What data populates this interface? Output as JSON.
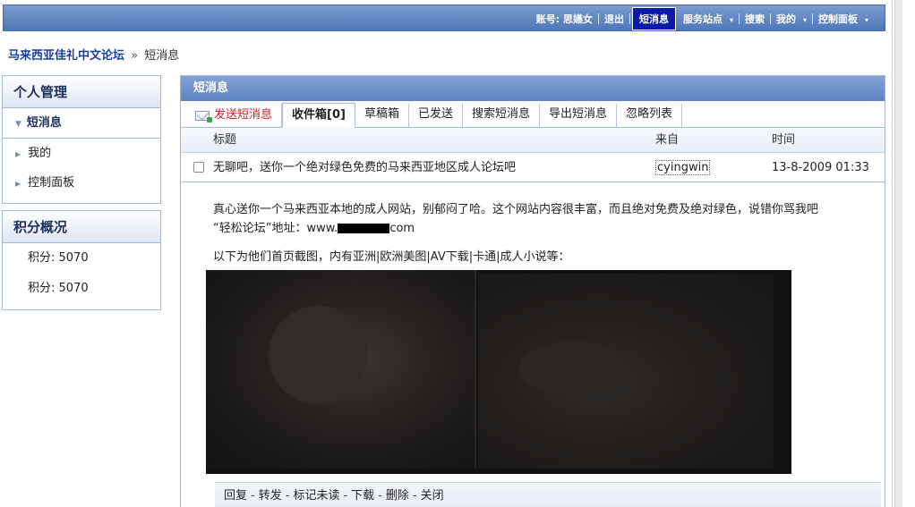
{
  "topnav": {
    "account": "账号: 思嬿女",
    "logout": "退出",
    "messages": "短消息",
    "services": "服务站点",
    "search": "搜索",
    "mine": "我的",
    "control_panel": "控制面板",
    "arrow": "▾"
  },
  "breadcrumb": {
    "home": "马来西亚佳礼中文论坛",
    "separator": "»",
    "current": "短消息"
  },
  "sidebar": {
    "personal": {
      "title": "个人管理",
      "active_item": "短消息",
      "items": [
        "我的",
        "控制面板"
      ]
    },
    "points": {
      "title": "积分概况",
      "rows": [
        "积分: 5070",
        "积分: 5070"
      ]
    }
  },
  "panel": {
    "title": "短消息",
    "tabs": [
      "发送短消息",
      "收件箱[0]",
      "草稿箱",
      "已发送",
      "搜索短消息",
      "导出短消息",
      "忽略列表"
    ],
    "columns": {
      "title": "标题",
      "from": "来自",
      "time": "时间"
    },
    "row": {
      "title": "无聊吧，送你一个绝对绿色免费的马来西亚地区成人论坛吧",
      "from": "cyingwin",
      "time": "13-8-2009 01:33"
    },
    "message": {
      "line1": "真心送你一个马来西亚本地的成人网站，别郁闷了哈。这个网站内容很丰富，而且绝对免费及绝对绿色，说错你骂我吧",
      "url_prefix": "“轻松论坛”地址：www.",
      "url_suffix": "com",
      "line3": "以下为他们首页截图，内有亚洲|欧洲美图|AV下载|卡通|成人小说等："
    },
    "actions": [
      "回复",
      "转发",
      "标记未读",
      "下载",
      "删除",
      "关闭"
    ],
    "action_sep": "-"
  }
}
